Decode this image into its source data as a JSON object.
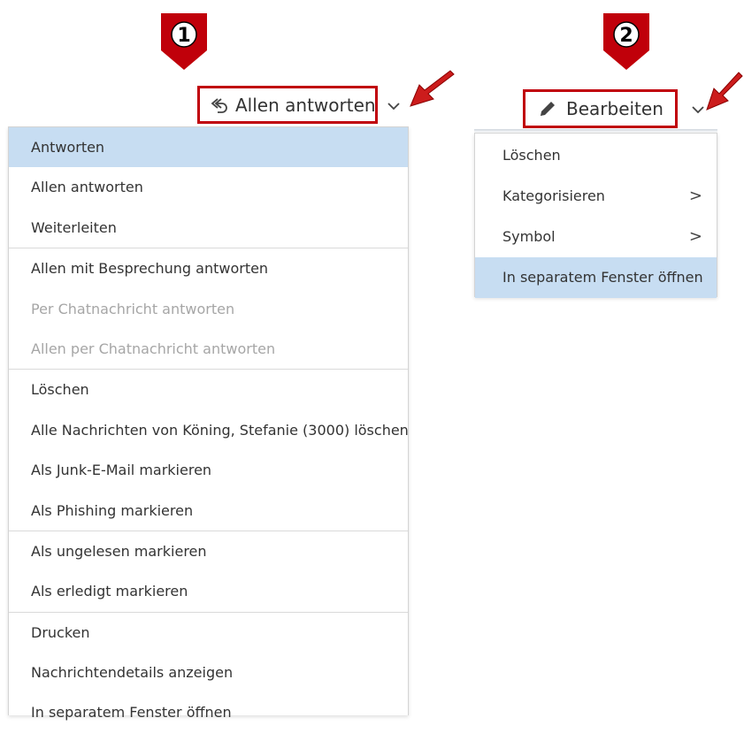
{
  "callouts": {
    "one": "1",
    "two": "2"
  },
  "colors": {
    "callout": "#c0000a",
    "selection": "#c7ddf2",
    "disabled_text": "#a6a6a6"
  },
  "reply_button": {
    "label": "Allen antworten",
    "icon": "reply-all-icon"
  },
  "edit_button": {
    "label": "Bearbeiten",
    "icon": "pencil-icon"
  },
  "reply_menu": {
    "items": [
      {
        "label": "Antworten",
        "state": "highlighted"
      },
      {
        "label": "Allen antworten"
      },
      {
        "label": "Weiterleiten"
      },
      {
        "label": "Allen mit Besprechung antworten"
      },
      {
        "label": "Per Chatnachricht antworten",
        "state": "disabled"
      },
      {
        "label": "Allen per Chatnachricht antworten",
        "state": "disabled"
      },
      {
        "label": "Löschen"
      },
      {
        "label": "Alle Nachrichten von Köning, Stefanie (3000) löschen"
      },
      {
        "label": "Als Junk-E-Mail markieren"
      },
      {
        "label": "Als Phishing markieren"
      },
      {
        "label": "Als ungelesen markieren"
      },
      {
        "label": "Als erledigt markieren"
      },
      {
        "label": "Drucken"
      },
      {
        "label": "Nachrichtendetails anzeigen"
      },
      {
        "label": "In separatem Fenster öffnen"
      }
    ]
  },
  "edit_menu": {
    "items": [
      {
        "label": "Löschen"
      },
      {
        "label": "Kategorisieren",
        "submenu": true,
        "submenu_glyph": ">"
      },
      {
        "label": "Symbol",
        "submenu": true,
        "submenu_glyph": ">"
      },
      {
        "label": "In separatem Fenster öffnen",
        "state": "highlighted"
      }
    ]
  }
}
